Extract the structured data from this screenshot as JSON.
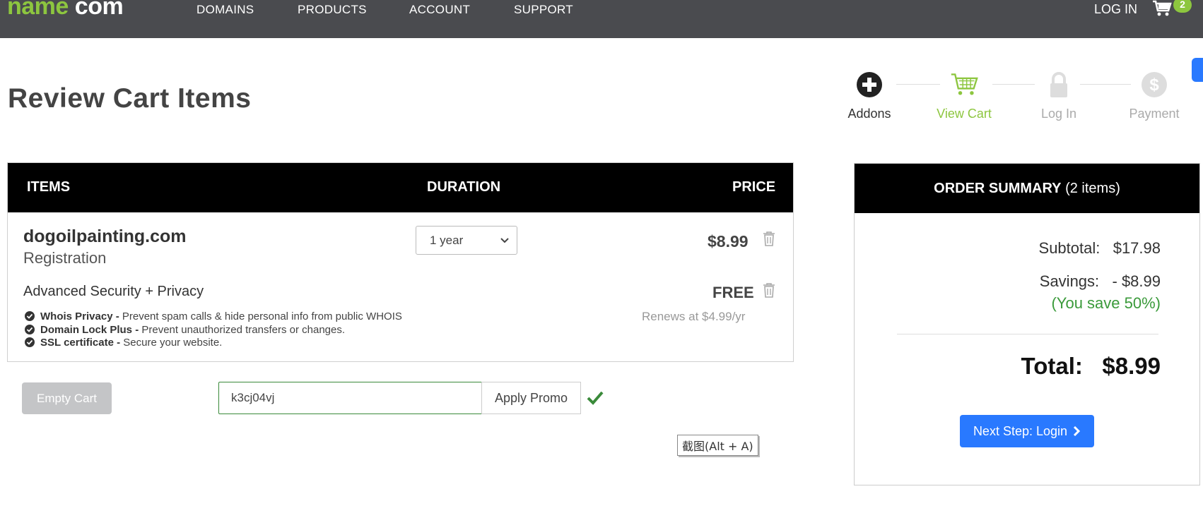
{
  "nav": {
    "logo": "name.com",
    "logo_parts": {
      "name": "name",
      "dot": ".",
      "com": "com"
    },
    "links": [
      "DOMAINS",
      "PRODUCTS",
      "ACCOUNT",
      "SUPPORT"
    ],
    "login": "LOG IN",
    "cart_count": "2"
  },
  "page": {
    "title": "Review Cart Items"
  },
  "steps": [
    {
      "label": "Addons",
      "icon": "plus-circle-icon",
      "state": "done"
    },
    {
      "label": "View Cart",
      "icon": "cart-icon",
      "state": "active"
    },
    {
      "label": "Log In",
      "icon": "lock-icon",
      "state": "upcoming"
    },
    {
      "label": "Payment",
      "icon": "dollar-circle-icon",
      "state": "upcoming"
    }
  ],
  "table": {
    "headers": {
      "items": "ITEMS",
      "duration": "DURATION",
      "price": "PRICE"
    },
    "domain": {
      "name": "dogoilpainting.com",
      "type": "Registration",
      "duration": "1 year",
      "price": "$8.99"
    },
    "addon": {
      "name": "Advanced Security + Privacy",
      "price": "FREE",
      "renews": "Renews at $4.99/yr",
      "features": [
        {
          "title": "Whois Privacy -",
          "desc": " Prevent spam calls & hide personal info from public WHOIS"
        },
        {
          "title": "Domain Lock Plus -",
          "desc": " Prevent unauthorized transfers or changes."
        },
        {
          "title": "SSL certificate -",
          "desc": " Secure your website."
        }
      ]
    }
  },
  "actions": {
    "empty_cart": "Empty Cart",
    "promo_value": "k3cj04vj",
    "apply_promo": "Apply Promo"
  },
  "tooltip": "截图(Alt + A)",
  "summary": {
    "title": "ORDER SUMMARY",
    "item_count": " (2 items)",
    "subtotal_label": "Subtotal:",
    "subtotal": "$17.98",
    "savings_label": "Savings:",
    "savings": "- $8.99",
    "save_pct": "(You save 50%)",
    "total_label": "Total:",
    "total": "$8.99",
    "next_button": "Next Step: Login"
  },
  "colors": {
    "nav_bg": "#4a4b4f",
    "brand_green": "#8dc63f",
    "primary_blue": "#2979ff",
    "success_green": "#3a9a3a"
  }
}
